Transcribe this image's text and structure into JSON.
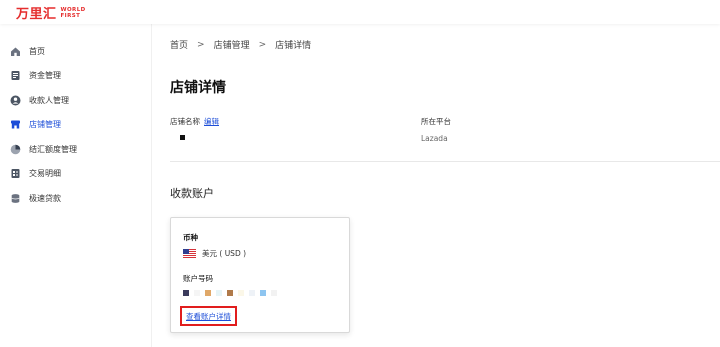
{
  "brand": {
    "name_cn": "万里汇",
    "name_en_line1": "WORLD",
    "name_en_line2": "FIRST",
    "color": "#e52e2e"
  },
  "sidebar": {
    "items": [
      {
        "label": "首页",
        "icon": "home-icon",
        "active": false
      },
      {
        "label": "资金管理",
        "icon": "fund-icon",
        "active": false
      },
      {
        "label": "收款人管理",
        "icon": "payee-icon",
        "active": false
      },
      {
        "label": "店铺管理",
        "icon": "store-icon",
        "active": true
      },
      {
        "label": "结汇额度管理",
        "icon": "quota-icon",
        "active": false
      },
      {
        "label": "交易明细",
        "icon": "transactions-icon",
        "active": false
      },
      {
        "label": "极速贷款",
        "icon": "loan-icon",
        "active": false
      }
    ]
  },
  "breadcrumb": {
    "items": [
      "首页",
      "店铺管理",
      "店铺详情"
    ],
    "separator": ">"
  },
  "page_title": "店铺详情",
  "store_info": {
    "name_label": "店铺名称",
    "edit_label": "编辑",
    "platform_label": "所在平台",
    "platform_value": "Lazada"
  },
  "accounts": {
    "section_title": "收款账户",
    "card": {
      "currency_label": "币种",
      "currency_value": "美元 ( USD )",
      "account_number_label": "账户号码",
      "view_details_label": "查看账户详情"
    }
  },
  "colors": {
    "accent": "#1d4ed8",
    "highlight_border": "#e11d1d"
  }
}
